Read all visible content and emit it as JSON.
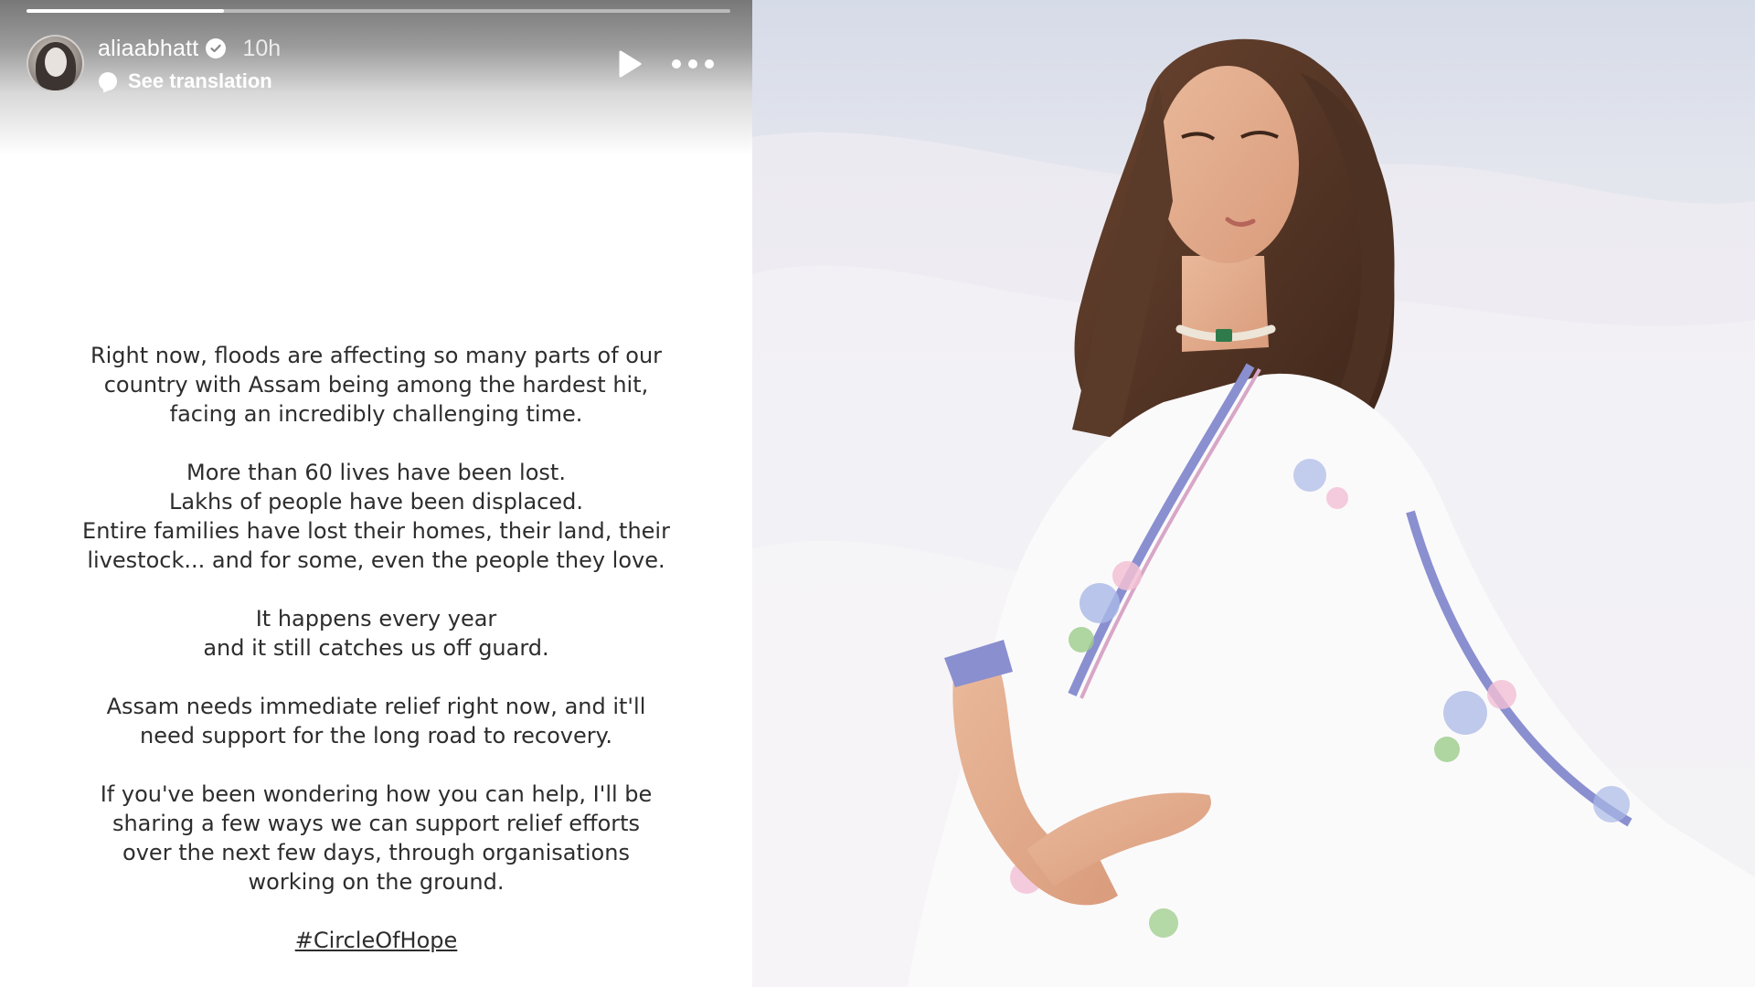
{
  "story": {
    "username": "aliaabhatt",
    "time_ago": "10h",
    "see_translation": "See translation",
    "progress": 0.28,
    "paragraphs": [
      {
        "lines": [
          "Right now, floods are affecting so many parts of our",
          "country with Assam being among the hardest hit,",
          "facing an incredibly challenging time."
        ]
      },
      {
        "lines": [
          "More than 60 lives have been lost.",
          "Lakhs of people have been displaced.",
          "Entire families have lost their homes, their land, their",
          "livestock... and for some, even the people they love."
        ]
      },
      {
        "lines": [
          "It happens every year",
          "and it still catches us off guard."
        ]
      },
      {
        "lines": [
          "Assam needs immediate relief right now, and it'll",
          "need support for the long road to recovery."
        ]
      },
      {
        "lines": [
          "If you've been wondering how you can help, I'll be",
          "sharing a few ways we can support relief efforts",
          "over the next few days, through organisations",
          "working on the ground."
        ]
      }
    ],
    "hashtag": "#CircleOfHope",
    "icons": {
      "verified": "verified-badge-icon",
      "translation": "speech-bubble-icon",
      "play": "play-icon",
      "more": "more-options-icon"
    }
  },
  "colors": {
    "story_background": "#ffffff",
    "story_text": "#2d2d2d",
    "header_overlay": "#787878",
    "photo_sky": "#d6dbe8",
    "photo_fabric": "#f1eef2",
    "saree_border": "#8a8fd0",
    "hair": "#5a3a28"
  }
}
